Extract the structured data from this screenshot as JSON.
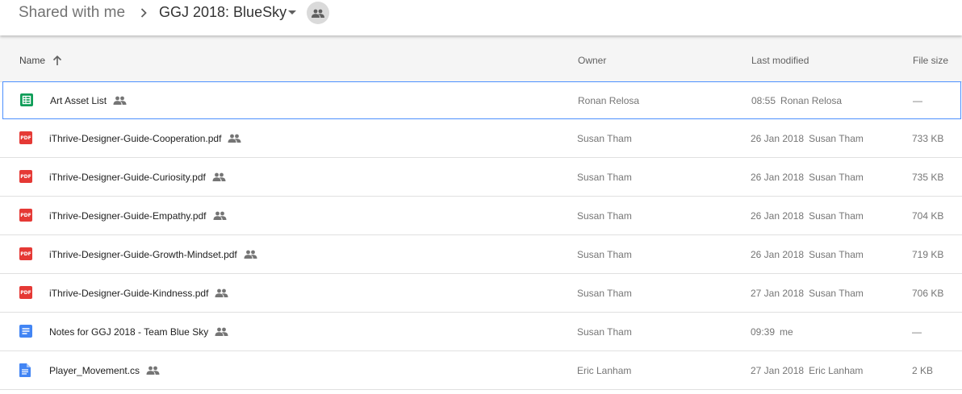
{
  "breadcrumb": {
    "root": "Shared with me",
    "current": "GGJ 2018: BlueSky"
  },
  "columns": {
    "name": "Name",
    "owner": "Owner",
    "last_modified": "Last modified",
    "file_size": "File size",
    "sort": "ascending"
  },
  "colors": {
    "sheet": "#0f9d58",
    "pdf": "#e53935",
    "doc": "#4285f4",
    "selection": "#4d90fe"
  },
  "files": [
    {
      "name": "Art Asset List",
      "icon": "sheets-icon",
      "owner": "Ronan Relosa",
      "modified_date": "08:55",
      "modified_by": "Ronan Relosa",
      "size": "—",
      "selected": true
    },
    {
      "name": "iThrive-Designer-Guide-Cooperation.pdf",
      "icon": "pdf-icon",
      "icon_text": "PDF",
      "owner": "Susan Tham",
      "modified_date": "26 Jan 2018",
      "modified_by": "Susan Tham",
      "size": "733 KB"
    },
    {
      "name": "iThrive-Designer-Guide-Curiosity.pdf",
      "icon": "pdf-icon",
      "icon_text": "PDF",
      "owner": "Susan Tham",
      "modified_date": "26 Jan 2018",
      "modified_by": "Susan Tham",
      "size": "735 KB"
    },
    {
      "name": "iThrive-Designer-Guide-Empathy.pdf",
      "icon": "pdf-icon",
      "icon_text": "PDF",
      "owner": "Susan Tham",
      "modified_date": "26 Jan 2018",
      "modified_by": "Susan Tham",
      "size": "704 KB"
    },
    {
      "name": "iThrive-Designer-Guide-Growth-Mindset.pdf",
      "icon": "pdf-icon",
      "icon_text": "PDF",
      "owner": "Susan Tham",
      "modified_date": "26 Jan 2018",
      "modified_by": "Susan Tham",
      "size": "719 KB"
    },
    {
      "name": "iThrive-Designer-Guide-Kindness.pdf",
      "icon": "pdf-icon",
      "icon_text": "PDF",
      "owner": "Susan Tham",
      "modified_date": "27 Jan 2018",
      "modified_by": "Susan Tham",
      "size": "706 KB"
    },
    {
      "name": "Notes for GGJ 2018 - Team Blue Sky",
      "icon": "docs-icon",
      "owner": "Susan Tham",
      "modified_date": "09:39",
      "modified_by": "me",
      "size": "—"
    },
    {
      "name": "Player_Movement.cs",
      "icon": "text-file-icon",
      "owner": "Eric Lanham",
      "modified_date": "27 Jan 2018",
      "modified_by": "Eric Lanham",
      "size": "2 KB"
    }
  ]
}
